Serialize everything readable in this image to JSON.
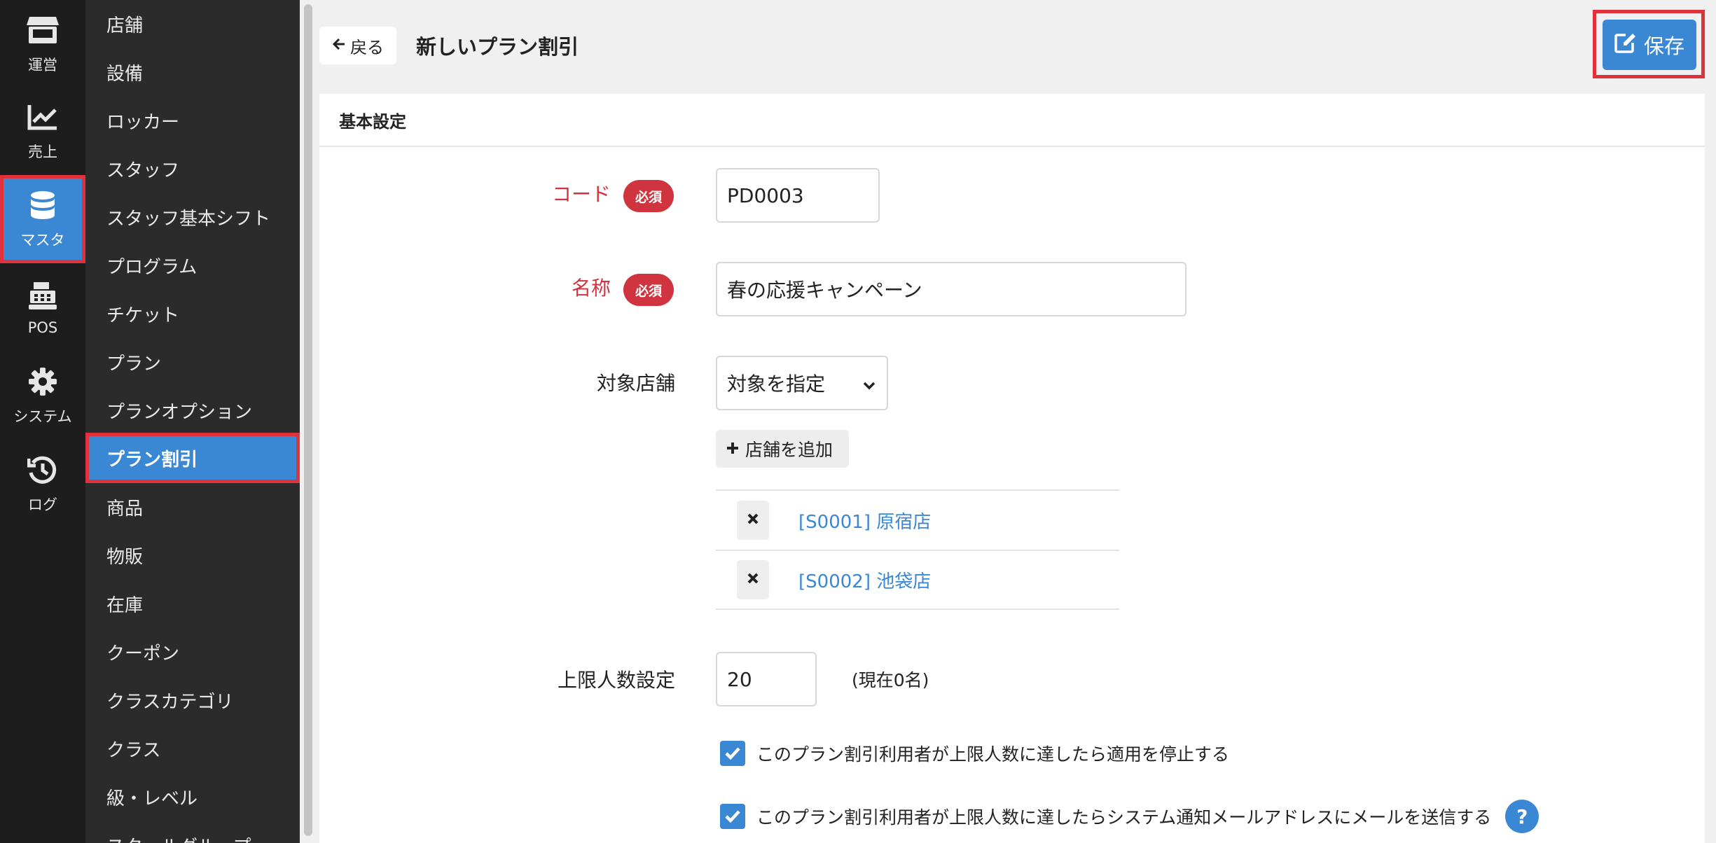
{
  "rail": [
    {
      "label": "運営",
      "icon": "store-icon"
    },
    {
      "label": "売上",
      "icon": "chart-line-icon"
    },
    {
      "label": "マスタ",
      "icon": "database-icon",
      "active": true
    },
    {
      "label": "POS",
      "icon": "cash-register-icon"
    },
    {
      "label": "システム",
      "icon": "gear-icon"
    },
    {
      "label": "ログ",
      "icon": "history-icon"
    }
  ],
  "nav": [
    "店舗",
    "設備",
    "ロッカー",
    "スタッフ",
    "スタッフ基本シフト",
    "プログラム",
    "チケット",
    "プラン",
    "プランオプション",
    "プラン割引",
    "商品",
    "物販",
    "在庫",
    "クーポン",
    "クラスカテゴリ",
    "クラス",
    "級・レベル",
    "スクールグループ"
  ],
  "nav_active_index": 9,
  "header": {
    "back_label": "戻る",
    "title": "新しいプラン割引",
    "save_label": "保存"
  },
  "panel": {
    "title": "基本設定"
  },
  "form": {
    "required_badge": "必須",
    "code_label": "コード",
    "code_value": "PD0003",
    "name_label": "名称",
    "name_value": "春の応援キャンペーン",
    "stores_label": "対象店舗",
    "stores_select": "対象を指定",
    "add_store_label": "店舗を追加",
    "stores": [
      "[S0001] 原宿店",
      "[S0002] 池袋店"
    ],
    "limit_label": "上限人数設定",
    "limit_value": "20",
    "limit_note": "(現在0名)",
    "check_stop": "このプラン割引利用者が上限人数に達したら適用を停止する",
    "check_mail": "このプラン割引利用者が上限人数に達したらシステム通知メールアドレスにメールを送信する",
    "help_glyph": "?"
  },
  "colors": {
    "accent": "#3a87d3",
    "required": "#d0343e",
    "highlight": "#e0323b",
    "rail_bg": "#1d1d1d",
    "nav_bg": "#2b2b2b"
  }
}
